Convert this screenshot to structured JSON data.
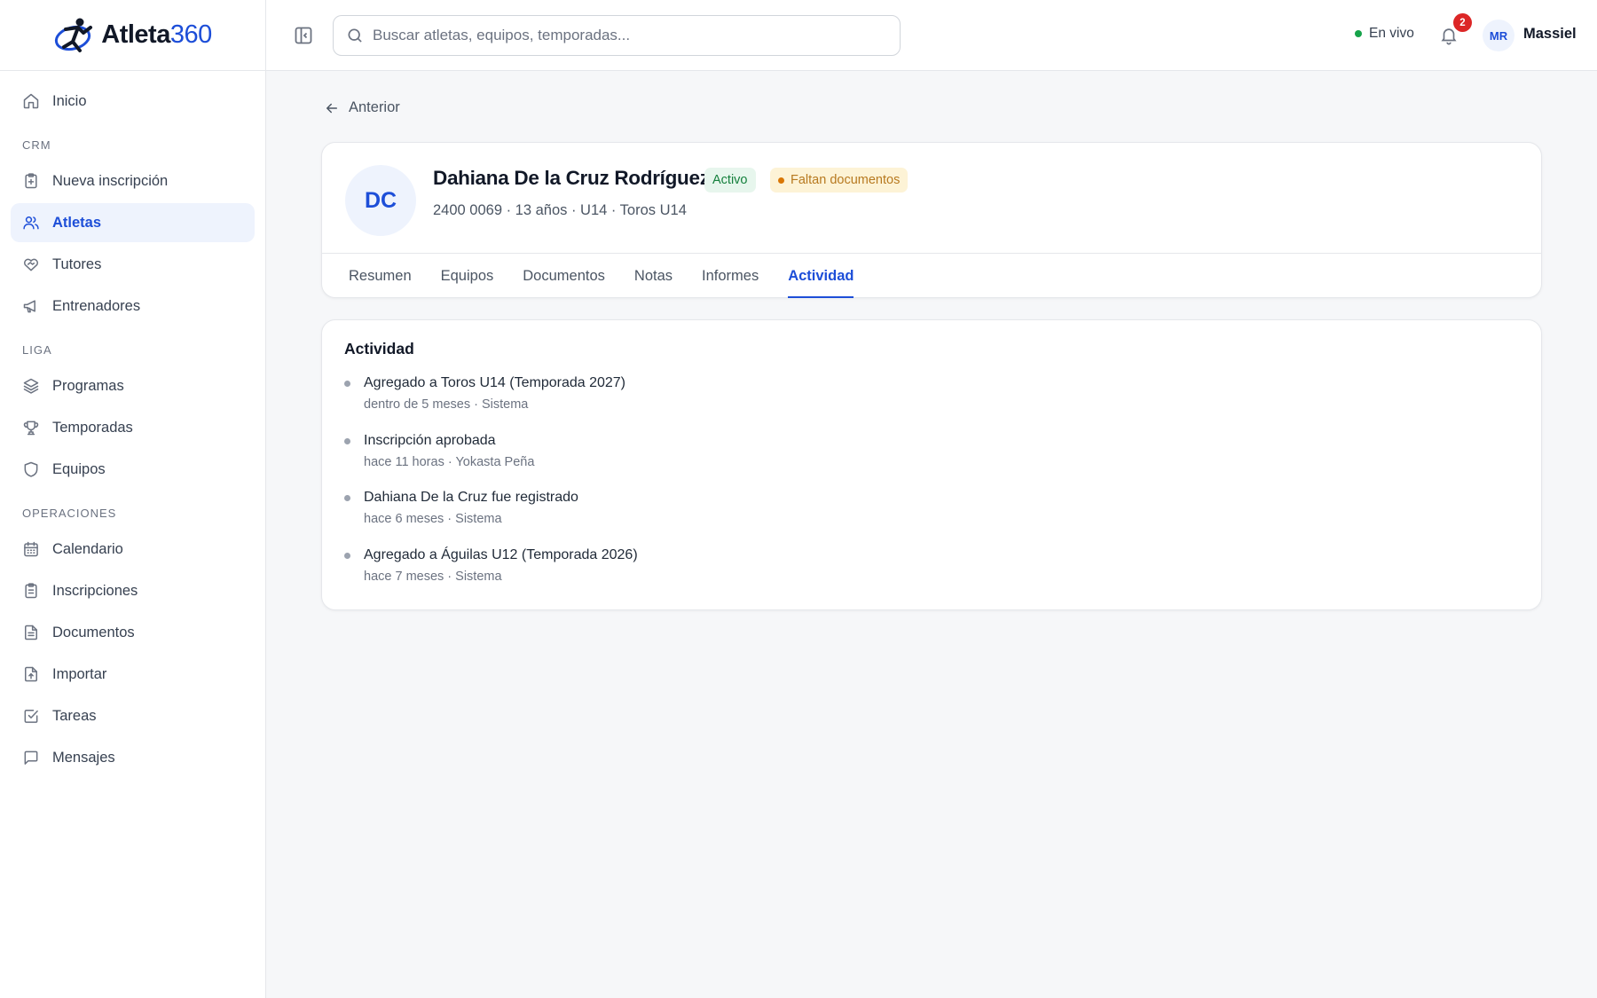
{
  "app": {
    "logo_text": "Atleta",
    "logo_number": "360"
  },
  "sidebar": {
    "top_items": [
      {
        "label": "Inicio",
        "icon": "home-icon"
      }
    ],
    "sections": [
      {
        "title": "CRM",
        "items": [
          {
            "label": "Nueva inscripción",
            "icon": "clipboard-plus-icon"
          },
          {
            "label": "Atletas",
            "icon": "users-icon",
            "active": true
          },
          {
            "label": "Tutores",
            "icon": "heart-handshake-icon"
          },
          {
            "label": "Entrenadores",
            "icon": "megaphone-icon"
          }
        ]
      },
      {
        "title": "LIGA",
        "items": [
          {
            "label": "Programas",
            "icon": "layers-icon"
          },
          {
            "label": "Temporadas",
            "icon": "trophy-icon"
          },
          {
            "label": "Equipos",
            "icon": "shield-icon"
          }
        ]
      },
      {
        "title": "OPERACIONES",
        "items": [
          {
            "label": "Calendario",
            "icon": "calendar-icon"
          },
          {
            "label": "Inscripciones",
            "icon": "clipboard-list-icon"
          },
          {
            "label": "Documentos",
            "icon": "file-text-icon"
          },
          {
            "label": "Importar",
            "icon": "file-upload-icon"
          },
          {
            "label": "Tareas",
            "icon": "check-square-icon"
          },
          {
            "label": "Mensajes",
            "icon": "message-square-icon"
          }
        ]
      }
    ]
  },
  "header": {
    "search_placeholder": "Buscar atletas, equipos, temporadas...",
    "live_label": "En vivo",
    "notification_count": "2",
    "user_initials": "MR",
    "user_name": "Massiel"
  },
  "main": {
    "back_label": "Anterior",
    "athlete": {
      "initials": "DC",
      "name": "Dahiana De la Cruz Rodríguez",
      "status_badge": "Activo",
      "warning_badge": "Faltan documentos",
      "meta": "2400 0069 · 13 años · U14 · Toros U14"
    },
    "tabs": [
      {
        "label": "Resumen"
      },
      {
        "label": "Equipos"
      },
      {
        "label": "Documentos"
      },
      {
        "label": "Notas"
      },
      {
        "label": "Informes"
      },
      {
        "label": "Actividad",
        "active": true
      }
    ],
    "activity": {
      "title": "Actividad",
      "items": [
        {
          "title": "Agregado a Toros U14 (Temporada 2027)",
          "sub": "dentro de 5 meses · Sistema"
        },
        {
          "title": "Inscripción aprobada",
          "sub": "hace 11 horas · Yokasta Peña"
        },
        {
          "title": "Dahiana De la Cruz fue registrado",
          "sub": "hace 6 meses · Sistema"
        },
        {
          "title": "Agregado a Águilas U12 (Temporada 2026)",
          "sub": "hace 7 meses · Sistema"
        }
      ]
    }
  },
  "colors": {
    "accent": "#1d4ed8",
    "active_bg": "#eef3fd",
    "success": "#15803d",
    "warning": "#b7791f",
    "danger": "#dc2626"
  }
}
